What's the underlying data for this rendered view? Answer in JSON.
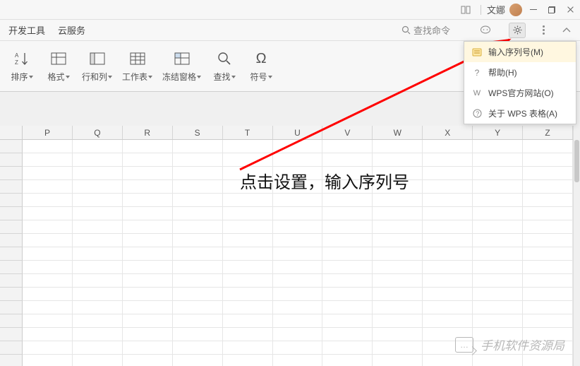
{
  "titlebar": {
    "username": "文娜"
  },
  "menubar": {
    "tabs": [
      "开发工具",
      "云服务"
    ],
    "search_placeholder": "查找命令"
  },
  "ribbon": {
    "tools": [
      {
        "label": "排序"
      },
      {
        "label": "格式"
      },
      {
        "label": "行和列"
      },
      {
        "label": "工作表"
      },
      {
        "label": "冻结窗格"
      },
      {
        "label": "查找"
      },
      {
        "label": "符号"
      }
    ]
  },
  "columns": [
    "P",
    "Q",
    "R",
    "S",
    "T",
    "U",
    "V",
    "W",
    "X",
    "Y",
    "Z"
  ],
  "dropdown": {
    "items": [
      {
        "icon": "serial",
        "label": "输入序列号(M)"
      },
      {
        "icon": "help",
        "label": "帮助(H)"
      },
      {
        "icon": "wps",
        "label": "WPS官方网站(O)"
      },
      {
        "icon": "about",
        "label": "关于 WPS 表格(A)"
      }
    ]
  },
  "annotation_text": "点击设置，输入序列号",
  "watermark_text": "手机软件资源局"
}
